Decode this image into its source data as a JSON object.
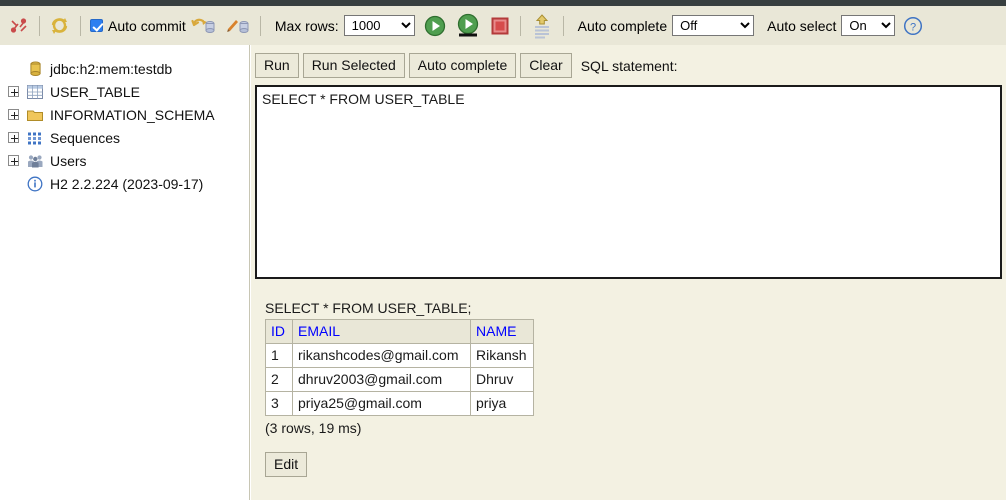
{
  "toolbar": {
    "disconnect_icon": "disconnect-icon",
    "refresh_icon": "refresh-icon",
    "auto_commit_label": "Auto commit",
    "auto_commit_checked": true,
    "rollback_icon": "rollback-icon",
    "commit_icon": "commit-icon",
    "max_rows_label": "Max rows:",
    "max_rows_value": "1000",
    "max_rows_options": [
      "1000"
    ],
    "run_icon": "run-icon",
    "run_selected_icon": "run-selected-icon",
    "stop_icon": "stop-icon",
    "history_icon": "history-icon",
    "auto_complete_label": "Auto complete",
    "auto_complete_value": "Off",
    "auto_complete_options": [
      "Off"
    ],
    "auto_select_label": "Auto select",
    "auto_select_value": "On",
    "auto_select_options": [
      "On"
    ],
    "help_icon": "help-icon"
  },
  "sidebar": {
    "items": [
      {
        "label": "jdbc:h2:mem:testdb",
        "icon": "database-icon",
        "expandable": false,
        "name": "sidebar-item-connection"
      },
      {
        "label": "USER_TABLE",
        "icon": "table-icon",
        "expandable": true,
        "name": "sidebar-item-user-table"
      },
      {
        "label": "INFORMATION_SCHEMA",
        "icon": "folder-icon",
        "expandable": true,
        "name": "sidebar-item-information-schema"
      },
      {
        "label": "Sequences",
        "icon": "sequences-icon",
        "expandable": true,
        "name": "sidebar-item-sequences"
      },
      {
        "label": "Users",
        "icon": "users-icon",
        "expandable": true,
        "name": "sidebar-item-users"
      },
      {
        "label": "H2 2.2.224 (2023-09-17)",
        "icon": "info-icon",
        "expandable": false,
        "name": "sidebar-item-version"
      }
    ]
  },
  "main": {
    "buttons": {
      "run": "Run",
      "run_selected": "Run Selected",
      "auto_complete": "Auto complete",
      "clear": "Clear"
    },
    "sql_caption": "SQL statement:",
    "sql_value": "SELECT * FROM USER_TABLE",
    "sql_placeholder": "",
    "result": {
      "statement": "SELECT * FROM USER_TABLE;",
      "columns": [
        "ID",
        "EMAIL",
        "NAME"
      ],
      "rows": [
        [
          "1",
          "rikanshcodes@gmail.com",
          "Rikansh"
        ],
        [
          "2",
          "dhruv2003@gmail.com",
          "Dhruv"
        ],
        [
          "3",
          "priya25@gmail.com",
          "priya"
        ]
      ],
      "status": "(3 rows, 19 ms)",
      "edit_label": "Edit"
    }
  },
  "colors": {
    "toolbar_bg": "#e9e7d7",
    "main_bg": "#f3f1e2",
    "topbar": "#373f3f",
    "header_text": "#0000ff",
    "accent_checkbox": "#2d7ff0"
  }
}
